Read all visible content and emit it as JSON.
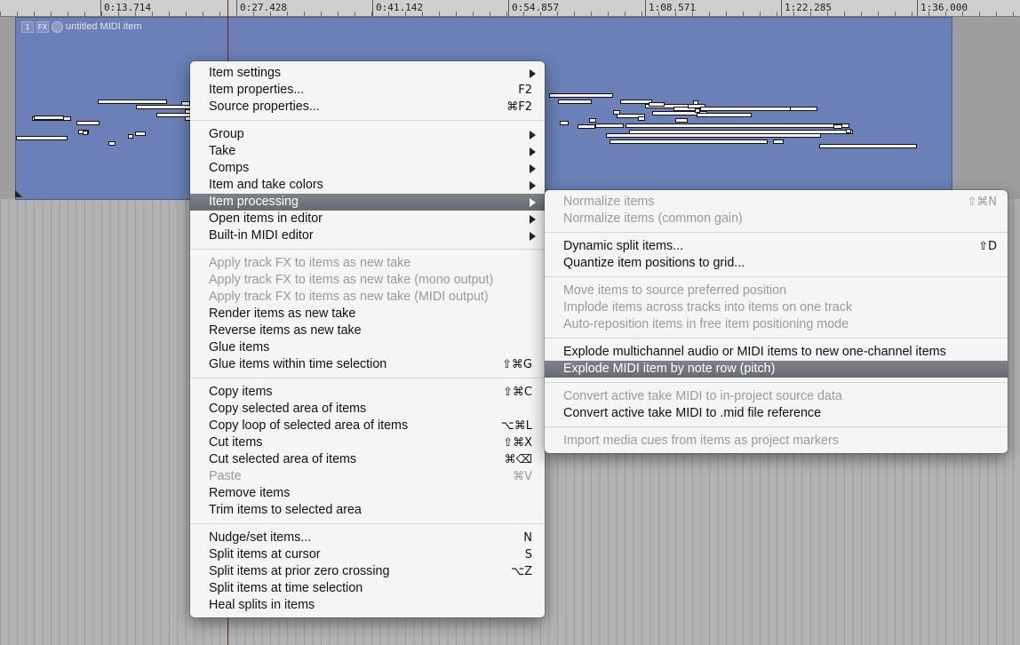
{
  "ruler": {
    "ticks": [
      {
        "label": "0:13.714"
      },
      {
        "label": "0:27.428"
      },
      {
        "label": "0:41.142"
      },
      {
        "label": "0:54.857"
      },
      {
        "label": "1:08.571"
      },
      {
        "label": "1:22.285"
      },
      {
        "label": "1:36.000"
      }
    ]
  },
  "item": {
    "name": "untitled MIDI item",
    "badge_1": "1",
    "badge_fx": "FX"
  },
  "colors": {
    "item_fill": "#6a80b6",
    "highlight": "#74777d",
    "disabled_text": "#9a9a9a"
  },
  "main_menu": {
    "item_settings": "Item settings",
    "item_properties": "Item properties...",
    "item_properties_sc": "F2",
    "source_properties": "Source properties...",
    "source_properties_sc": "⌘F2",
    "group": "Group",
    "take": "Take",
    "comps": "Comps",
    "item_take_colors": "Item and take colors",
    "item_processing": "Item processing",
    "open_in_editor": "Open items in editor",
    "builtin_midi_editor": "Built-in MIDI editor",
    "apply_fx_new_take": "Apply track FX to items as new take",
    "apply_fx_mono": "Apply track FX to items as new take (mono output)",
    "apply_fx_midi": "Apply track FX to items as new take (MIDI output)",
    "render_new_take": "Render items as new take",
    "reverse_new_take": "Reverse items as new take",
    "glue_items": "Glue items",
    "glue_time_selection": "Glue items within time selection",
    "glue_time_selection_sc": "⇧⌘G",
    "copy_items": "Copy items",
    "copy_items_sc": "⇧⌘C",
    "copy_selected_area": "Copy selected area of items",
    "copy_loop": "Copy loop of selected area of items",
    "copy_loop_sc": "⌥⌘L",
    "cut_items": "Cut items",
    "cut_items_sc": "⇧⌘X",
    "cut_selected_area": "Cut selected area of items",
    "cut_selected_area_sc": "⌘⌫",
    "paste": "Paste",
    "paste_sc": "⌘V",
    "remove_items": "Remove items",
    "trim_items": "Trim items to selected area",
    "nudge_set": "Nudge/set items...",
    "nudge_set_sc": "N",
    "split_cursor": "Split items at cursor",
    "split_cursor_sc": "S",
    "split_zero": "Split items at prior zero crossing",
    "split_zero_sc": "⌥Z",
    "split_time_sel": "Split items at time selection",
    "heal_splits": "Heal splits in items"
  },
  "sub_menu": {
    "normalize": "Normalize items",
    "normalize_sc": "⇧⌘N",
    "normalize_common": "Normalize items (common gain)",
    "dynamic_split": "Dynamic split items...",
    "dynamic_split_sc": "⇧D",
    "quantize_grid": "Quantize item positions to grid...",
    "move_source_pos": "Move items to source preferred position",
    "implode_tracks": "Implode items across tracks into items on one track",
    "auto_reposition": "Auto-reposition items in free item positioning mode",
    "explode_multichannel": "Explode multichannel audio or MIDI items to new one-channel items",
    "explode_midi_pitch": "Explode MIDI item by note row (pitch)",
    "convert_in_project": "Convert active take MIDI to in-project source data",
    "convert_mid_ref": "Convert active take MIDI to .mid file reference",
    "import_cues": "Import media cues from items as project markers"
  }
}
